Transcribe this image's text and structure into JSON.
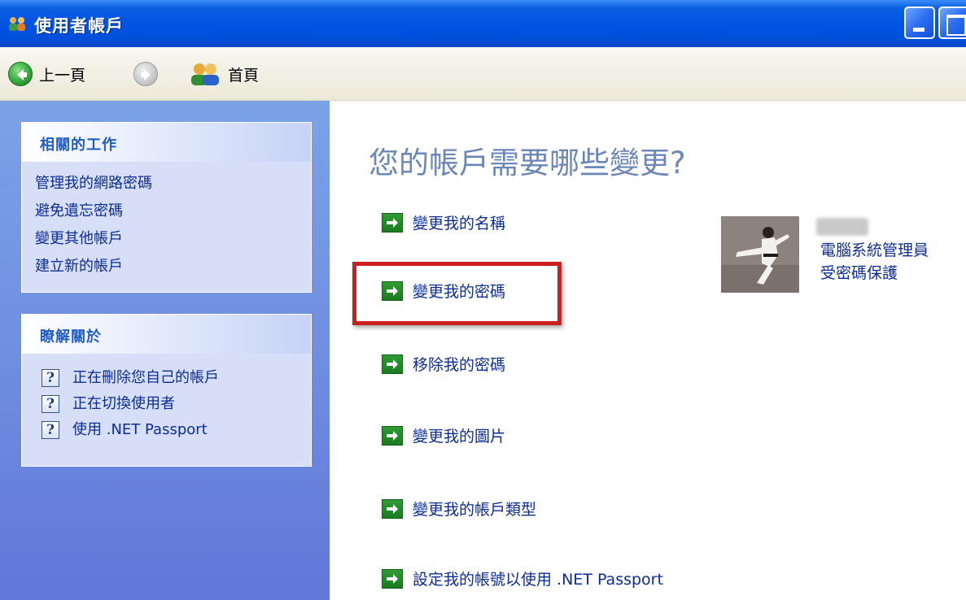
{
  "window": {
    "title": "使用者帳戶"
  },
  "toolbar": {
    "back_label": "上一頁",
    "home_label": "首頁"
  },
  "sidebar": {
    "related_tasks": {
      "title": "相關的工作",
      "items": [
        "管理我的網路密碼",
        "避免遺忘密碼",
        "變更其他帳戶",
        "建立新的帳戶"
      ]
    },
    "learn_about": {
      "title": "瞭解關於",
      "items": [
        "正在刪除您自己的帳戶",
        "正在切換使用者",
        "使用 .NET Passport"
      ]
    }
  },
  "main": {
    "heading": "您的帳戶需要哪些變更?",
    "actions": [
      "變更我的名稱",
      "變更我的密碼",
      "移除我的密碼",
      "變更我的圖片",
      "變更我的帳戶類型",
      "設定我的帳號以使用 .NET Passport"
    ]
  },
  "account": {
    "role": "電腦系統管理員",
    "status": "受密碼保護"
  },
  "colors": {
    "titlebar_blue": "#0154e3",
    "sidebar_blue": "#6f8fe0",
    "link_blue": "#0d2c94",
    "highlight_red": "#cc1f1f",
    "action_green": "#1b7a20"
  }
}
